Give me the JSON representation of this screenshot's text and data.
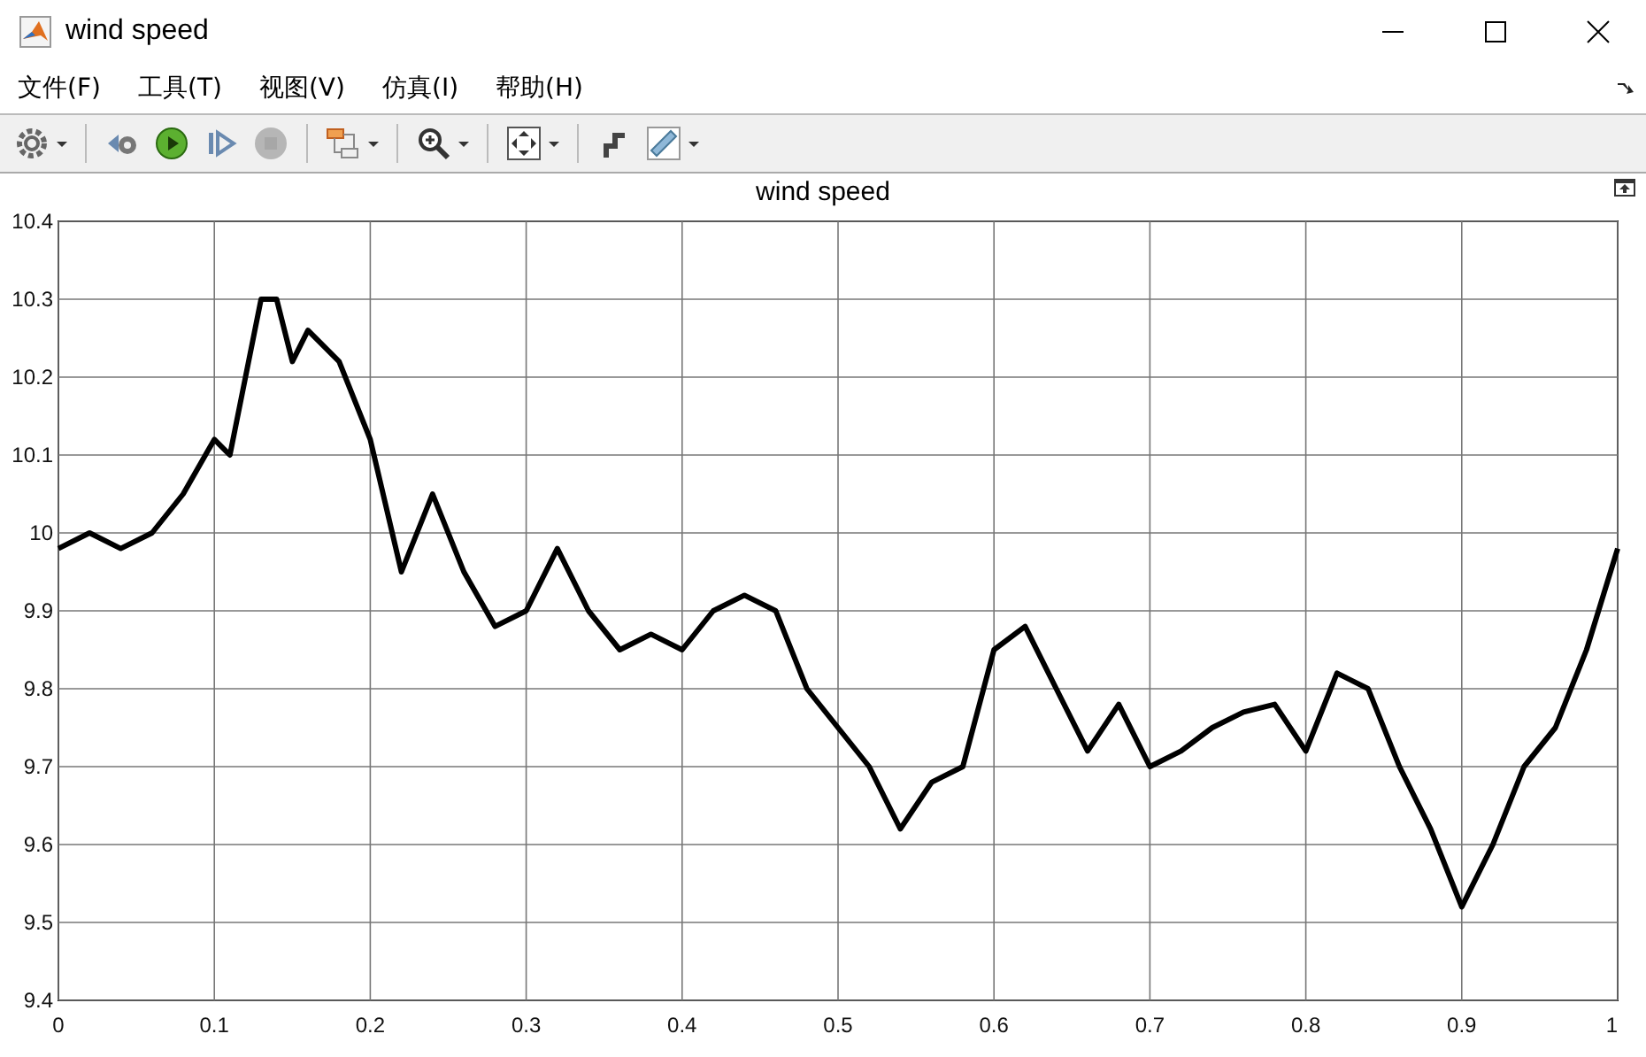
{
  "window": {
    "title": "wind speed"
  },
  "menu": [
    {
      "label": "文件(F)"
    },
    {
      "label": "工具(T)"
    },
    {
      "label": "视图(V)"
    },
    {
      "label": "仿真(I)"
    },
    {
      "label": "帮助(H)"
    }
  ],
  "toolbar": [
    {
      "kind": "settings",
      "dropdown": true,
      "disabled": false
    },
    {
      "kind": "step-back",
      "dropdown": false,
      "disabled": false
    },
    {
      "kind": "run",
      "dropdown": false,
      "disabled": false
    },
    {
      "kind": "step-forward",
      "dropdown": false,
      "disabled": false
    },
    {
      "kind": "stop",
      "dropdown": false,
      "disabled": true
    },
    {
      "kind": "signals",
      "dropdown": true,
      "disabled": false
    },
    {
      "kind": "zoom",
      "dropdown": true,
      "disabled": false
    },
    {
      "kind": "fit",
      "dropdown": true,
      "disabled": false
    },
    {
      "kind": "highlight",
      "dropdown": false,
      "disabled": false
    },
    {
      "kind": "measure",
      "dropdown": true,
      "disabled": false
    }
  ],
  "plot": {
    "chart_data": {
      "type": "line",
      "title": "wind speed",
      "grid": true,
      "xlim": [
        0,
        1
      ],
      "ylim": [
        9.4,
        10.4
      ],
      "xticks": [
        {
          "value": 0,
          "label": "0"
        },
        {
          "value": 0.1,
          "label": "0.1"
        },
        {
          "value": 0.2,
          "label": "0.2"
        },
        {
          "value": 0.3,
          "label": "0.3"
        },
        {
          "value": 0.4,
          "label": "0.4"
        },
        {
          "value": 0.5,
          "label": "0.5"
        },
        {
          "value": 0.6,
          "label": "0.6"
        },
        {
          "value": 0.7,
          "label": "0.7"
        },
        {
          "value": 0.8,
          "label": "0.8"
        },
        {
          "value": 0.9,
          "label": "0.9"
        },
        {
          "value": 1,
          "label": "1"
        }
      ],
      "yticks": [
        {
          "value": 9.4,
          "label": "9.4"
        },
        {
          "value": 9.5,
          "label": "9.5"
        },
        {
          "value": 9.6,
          "label": "9.6"
        },
        {
          "value": 9.7,
          "label": "9.7"
        },
        {
          "value": 9.8,
          "label": "9.8"
        },
        {
          "value": 9.9,
          "label": "9.9"
        },
        {
          "value": 10,
          "label": "10"
        },
        {
          "value": 10.1,
          "label": "10.1"
        },
        {
          "value": 10.2,
          "label": "10.2"
        },
        {
          "value": 10.3,
          "label": "10.3"
        },
        {
          "value": 10.4,
          "label": "10.4"
        }
      ],
      "x": [
        0,
        0.02,
        0.04,
        0.06,
        0.08,
        0.1,
        0.11,
        0.12,
        0.13,
        0.14,
        0.15,
        0.16,
        0.18,
        0.2,
        0.22,
        0.24,
        0.26,
        0.28,
        0.3,
        0.32,
        0.34,
        0.36,
        0.38,
        0.4,
        0.42,
        0.44,
        0.46,
        0.48,
        0.5,
        0.52,
        0.54,
        0.56,
        0.58,
        0.6,
        0.62,
        0.64,
        0.66,
        0.68,
        0.7,
        0.72,
        0.74,
        0.76,
        0.78,
        0.8,
        0.82,
        0.84,
        0.86,
        0.88,
        0.9,
        0.92,
        0.94,
        0.96,
        0.98,
        1
      ],
      "series": [
        {
          "color": "#000000",
          "values": [
            9.98,
            10.0,
            9.98,
            10.0,
            10.05,
            10.12,
            10.1,
            10.2,
            10.3,
            10.3,
            10.22,
            10.26,
            10.22,
            10.12,
            9.95,
            10.05,
            9.95,
            9.88,
            9.9,
            9.98,
            9.9,
            9.85,
            9.87,
            9.85,
            9.9,
            9.92,
            9.9,
            9.8,
            9.75,
            9.7,
            9.62,
            9.68,
            9.7,
            9.85,
            9.88,
            9.8,
            9.72,
            9.78,
            9.7,
            9.72,
            9.75,
            9.77,
            9.78,
            9.72,
            9.82,
            9.8,
            9.7,
            9.62,
            9.52,
            9.6,
            9.7,
            9.75,
            9.85,
            9.98
          ]
        }
      ]
    }
  }
}
